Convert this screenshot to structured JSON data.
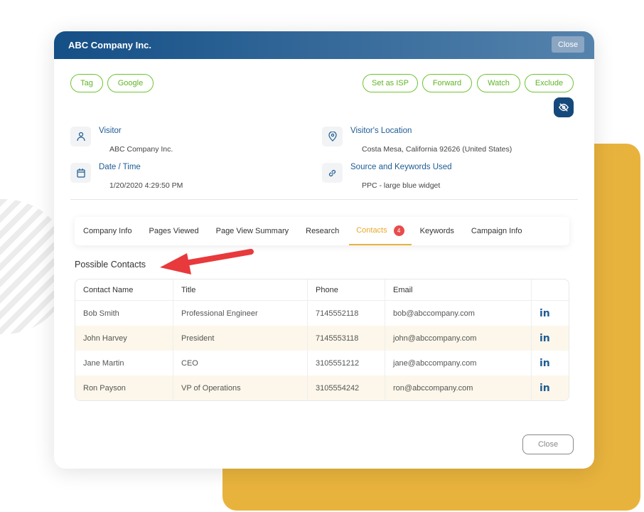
{
  "header": {
    "title": "ABC Company Inc.",
    "close_label": "Close"
  },
  "actions_left": [
    "Tag",
    "Google"
  ],
  "actions_right": [
    "Set as ISP",
    "Forward",
    "Watch",
    "Exclude"
  ],
  "info": {
    "visitor": {
      "label": "Visitor",
      "value": "ABC Company Inc."
    },
    "datetime": {
      "label": "Date / Time",
      "value": "1/20/2020 4:29:50 PM"
    },
    "location": {
      "label": "Visitor's Location",
      "value": "Costa Mesa, California 92626 (United States)"
    },
    "source": {
      "label": "Source and Keywords Used",
      "value": "PPC - large blue widget"
    }
  },
  "tabs": [
    "Company Info",
    "Pages Viewed",
    "Page View Summary",
    "Research",
    "Contacts",
    "Keywords",
    "Campaign Info"
  ],
  "active_tab": "Contacts",
  "contacts_badge": "4",
  "section_title": "Possible Contacts",
  "table": {
    "columns": [
      "Contact Name",
      "Title",
      "Phone",
      "Email"
    ],
    "rows": [
      [
        "Bob Smith",
        "Professional Engineer",
        "7145552118",
        "bob@abccompany.com"
      ],
      [
        "John Harvey",
        "President",
        "7145553118",
        "john@abccompany.com"
      ],
      [
        "Jane Martin",
        "CEO",
        "3105551212",
        "jane@abccompany.com"
      ],
      [
        "Ron Payson",
        "VP of Operations",
        "3105554242",
        "ron@abccompany.com"
      ]
    ],
    "linkedin_icon": "in"
  },
  "footer": {
    "close_label": "Close"
  },
  "colors": {
    "header": "#144f86",
    "accent_green": "#6ec431",
    "accent_yellow": "#e8b33d",
    "badge": "#e84c4c"
  }
}
